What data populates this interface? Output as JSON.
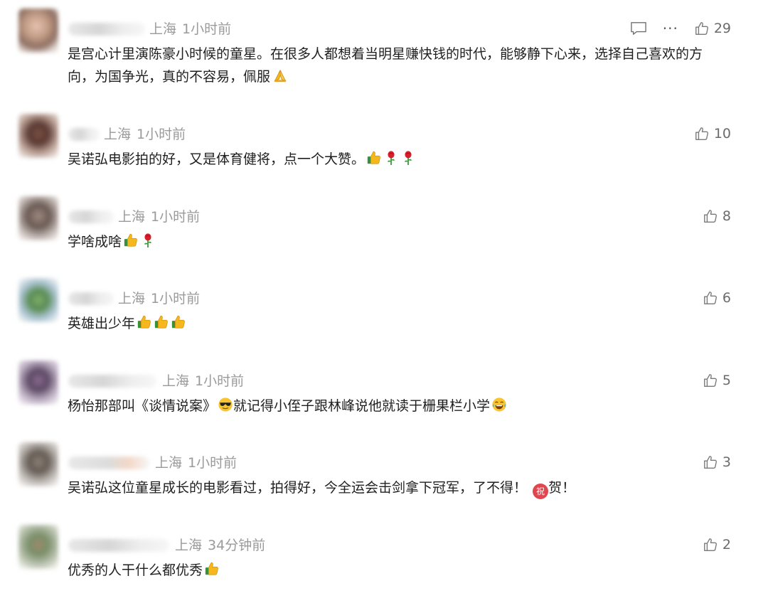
{
  "comments": [
    {
      "location": "上海",
      "time": "1小时前",
      "text": "是宫心计里演陈豪小时候的童星。在很多人都想着当明星赚快钱的时代，能够静下心来，选择自己喜欢的方向，为国争光，真的不容易，佩服",
      "likes": "29",
      "has_reply_more": true,
      "emojis": [
        "pray-emoji"
      ]
    },
    {
      "location": "上海",
      "time": "1小时前",
      "text": "吴诺弘电影拍的好，又是体育健将，点一个大赞。",
      "likes": "10",
      "emojis": [
        "thumbs-up-emoji",
        "rose-emoji",
        "rose-emoji"
      ]
    },
    {
      "location": "上海",
      "time": "1小时前",
      "text": "学啥成啥",
      "likes": "8",
      "emojis": [
        "thumbs-up-emoji",
        "rose-emoji"
      ]
    },
    {
      "location": "上海",
      "time": "1小时前",
      "text": "英雄出少年",
      "likes": "6",
      "emojis": [
        "thumbs-up-emoji",
        "thumbs-up-emoji",
        "thumbs-up-emoji"
      ]
    },
    {
      "location": "上海",
      "time": "1小时前",
      "text_before": "杨怡那部叫《谈情说案》",
      "text_after": "就记得小侄子跟林峰说他就读于栅果栏小学",
      "likes": "5",
      "emojis": [
        "sunglasses-emoji",
        "laugh-cry-emoji"
      ]
    },
    {
      "location": "上海",
      "time": "1小时前",
      "text": "吴诺弘这位童星成长的电影看过，拍得好，今全运会击剑拿下冠军，了不得！",
      "text_after": "贺！",
      "likes": "3",
      "emojis": [
        "congrats-badge-emoji"
      ],
      "badge_char": "祝"
    },
    {
      "location": "上海",
      "time": "34分钟前",
      "text": "优秀的人干什么都优秀",
      "likes": "2",
      "emojis": [
        "thumbs-up-emoji"
      ]
    }
  ],
  "colors": {
    "meta_text": "#9a9a9a",
    "body_text": "#1f1f1f",
    "like_text": "#6b6b6b",
    "badge": "#e0464e"
  },
  "icons": {
    "like": "thumbs-up-outline-icon",
    "reply": "comment-bubble-icon",
    "more": "more-dots-icon"
  },
  "more_label": "···"
}
